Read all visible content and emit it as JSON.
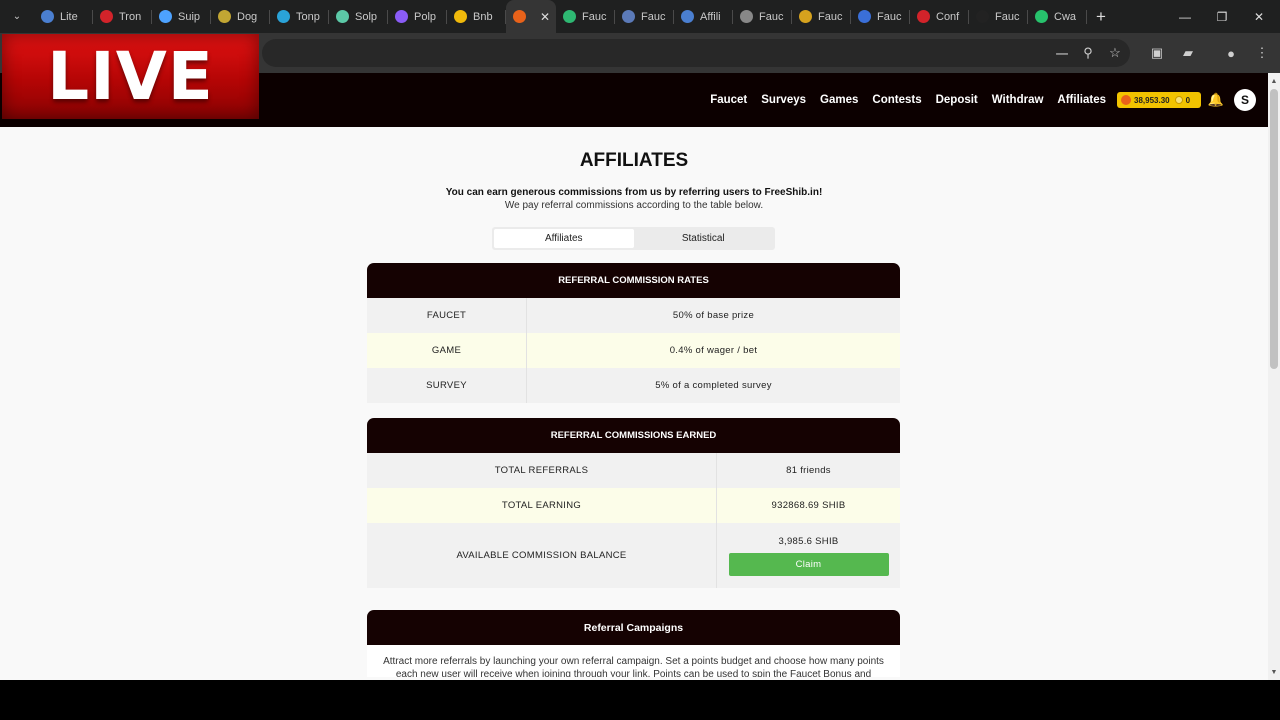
{
  "browser": {
    "tabs": [
      {
        "label": "Lite",
        "icon": "litecoin-favicon",
        "color": "#4a7fd1"
      },
      {
        "label": "Tron",
        "icon": "tron-favicon",
        "color": "#d2232a"
      },
      {
        "label": "Suip",
        "icon": "sui-favicon",
        "color": "#4da2ff"
      },
      {
        "label": "Dog",
        "icon": "doge-favicon",
        "color": "#c2a633"
      },
      {
        "label": "Tonp",
        "icon": "ton-favicon",
        "color": "#2aa3d8"
      },
      {
        "label": "Solp",
        "icon": "solana-favicon",
        "color": "#5cc9a7"
      },
      {
        "label": "Polp",
        "icon": "polkadot-favicon",
        "color": "#8a5cf6"
      },
      {
        "label": "Bnb",
        "icon": "bnb-favicon",
        "color": "#f0b90b"
      },
      {
        "label": "",
        "icon": "shiba-favicon",
        "color": "#e8621a",
        "active": true
      },
      {
        "label": "Fauc",
        "icon": "faucet-favicon",
        "color": "#2eb872"
      },
      {
        "label": "Fauc",
        "icon": "faucet-favicon",
        "color": "#5b7ab8"
      },
      {
        "label": "Affili",
        "icon": "affiliate-favicon",
        "color": "#4a7fd1"
      },
      {
        "label": "Fauc",
        "icon": "faucet-favicon",
        "color": "#888888"
      },
      {
        "label": "Fauc",
        "icon": "faucet-favicon",
        "color": "#d6a21e"
      },
      {
        "label": "Fauc",
        "icon": "faucet-favicon",
        "color": "#3a6fd8"
      },
      {
        "label": "Conf",
        "icon": "confirm-favicon",
        "color": "#d2232a"
      },
      {
        "label": "Fauc",
        "icon": "faucet-favicon",
        "color": "#222222"
      },
      {
        "label": "Cwa",
        "icon": "cwallet-favicon",
        "color": "#27c26c"
      }
    ]
  },
  "live_overlay": {
    "text": "LIVE"
  },
  "nav": {
    "links": [
      "Faucet",
      "Surveys",
      "Games",
      "Contests",
      "Deposit",
      "Withdraw",
      "Affiliates"
    ],
    "balance": "38,953.30",
    "coins": "0",
    "avatar_letter": "S"
  },
  "page": {
    "title": "AFFILIATES",
    "intro_bold": "You can earn generous commissions from us by referring users to FreeShib.in!",
    "intro": "We pay referral commissions according to the table below.",
    "tabs": [
      "Affiliates",
      "Statistical"
    ]
  },
  "rates": {
    "heading": "REFERRAL COMMISSION RATES",
    "rows": [
      {
        "label": "FAUCET",
        "value": "50% of base prize"
      },
      {
        "label": "GAME",
        "value": "0.4% of wager / bet"
      },
      {
        "label": "SURVEY",
        "value": "5% of a completed survey"
      }
    ]
  },
  "earned": {
    "heading": "REFERRAL COMMISSIONS EARNED",
    "total_referrals_label": "TOTAL REFERRALS",
    "total_referrals_value": "81 friends",
    "total_earning_label": "TOTAL EARNING",
    "total_earning_value": "932868.69 SHIB",
    "available_label": "AVAILABLE COMMISSION BALANCE",
    "available_value": "3,985.6 SHIB",
    "claim_label": "Claim"
  },
  "campaigns": {
    "heading": "Referral Campaigns",
    "text": "Attract more referrals by launching your own referral campaign. Set a points budget and choose how many points each new user will receive when joining through your link. Points can be used to spin the Faucet Bonus and unlock"
  },
  "colors": {
    "nav_bg": "#0c0000",
    "card_head": "#150202",
    "claim": "#55b84f",
    "balance": "#f2c300"
  }
}
